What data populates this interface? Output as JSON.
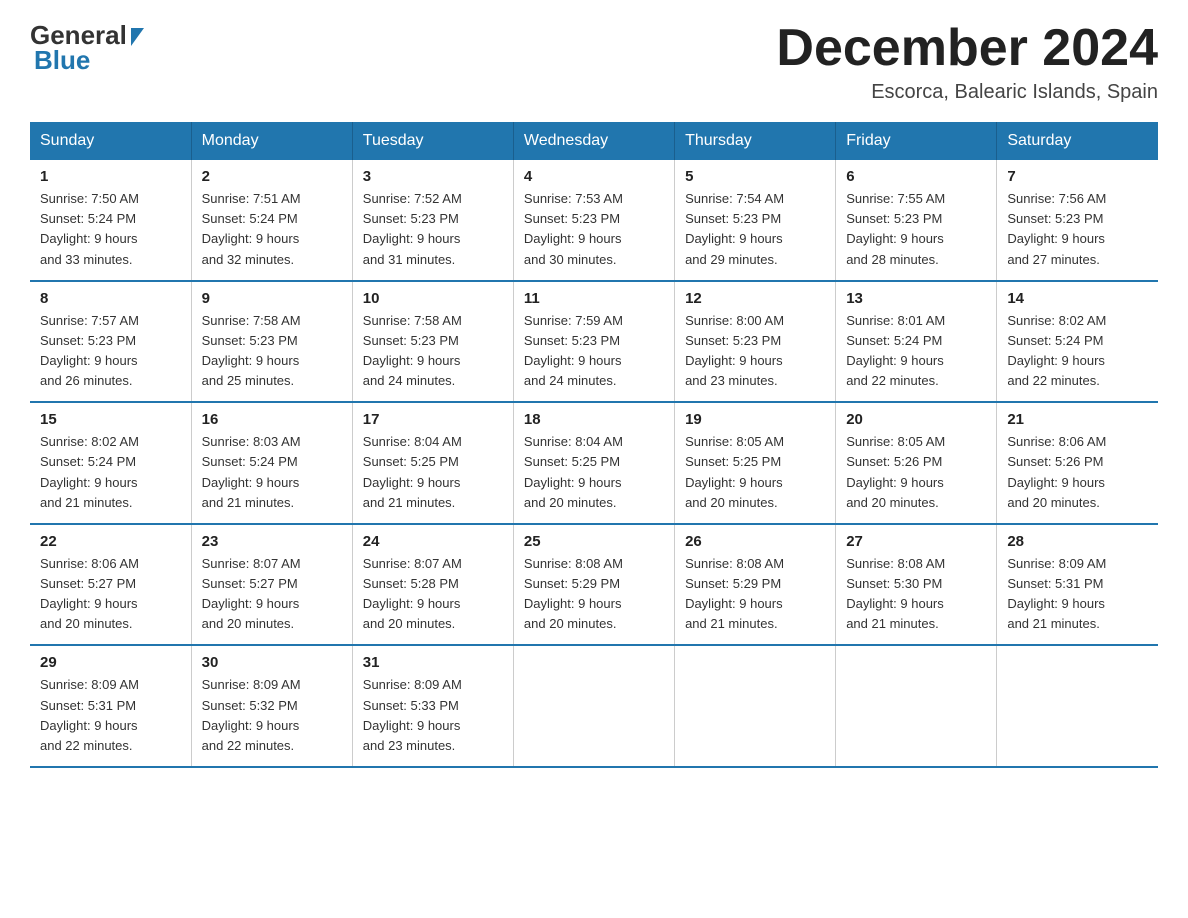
{
  "header": {
    "logo_general": "General",
    "logo_blue": "Blue",
    "month_title": "December 2024",
    "subtitle": "Escorca, Balearic Islands, Spain"
  },
  "weekdays": [
    "Sunday",
    "Monday",
    "Tuesday",
    "Wednesday",
    "Thursday",
    "Friday",
    "Saturday"
  ],
  "weeks": [
    [
      {
        "day": "1",
        "sunrise": "7:50 AM",
        "sunset": "5:24 PM",
        "daylight": "9 hours and 33 minutes."
      },
      {
        "day": "2",
        "sunrise": "7:51 AM",
        "sunset": "5:24 PM",
        "daylight": "9 hours and 32 minutes."
      },
      {
        "day": "3",
        "sunrise": "7:52 AM",
        "sunset": "5:23 PM",
        "daylight": "9 hours and 31 minutes."
      },
      {
        "day": "4",
        "sunrise": "7:53 AM",
        "sunset": "5:23 PM",
        "daylight": "9 hours and 30 minutes."
      },
      {
        "day": "5",
        "sunrise": "7:54 AM",
        "sunset": "5:23 PM",
        "daylight": "9 hours and 29 minutes."
      },
      {
        "day": "6",
        "sunrise": "7:55 AM",
        "sunset": "5:23 PM",
        "daylight": "9 hours and 28 minutes."
      },
      {
        "day": "7",
        "sunrise": "7:56 AM",
        "sunset": "5:23 PM",
        "daylight": "9 hours and 27 minutes."
      }
    ],
    [
      {
        "day": "8",
        "sunrise": "7:57 AM",
        "sunset": "5:23 PM",
        "daylight": "9 hours and 26 minutes."
      },
      {
        "day": "9",
        "sunrise": "7:58 AM",
        "sunset": "5:23 PM",
        "daylight": "9 hours and 25 minutes."
      },
      {
        "day": "10",
        "sunrise": "7:58 AM",
        "sunset": "5:23 PM",
        "daylight": "9 hours and 24 minutes."
      },
      {
        "day": "11",
        "sunrise": "7:59 AM",
        "sunset": "5:23 PM",
        "daylight": "9 hours and 24 minutes."
      },
      {
        "day": "12",
        "sunrise": "8:00 AM",
        "sunset": "5:23 PM",
        "daylight": "9 hours and 23 minutes."
      },
      {
        "day": "13",
        "sunrise": "8:01 AM",
        "sunset": "5:24 PM",
        "daylight": "9 hours and 22 minutes."
      },
      {
        "day": "14",
        "sunrise": "8:02 AM",
        "sunset": "5:24 PM",
        "daylight": "9 hours and 22 minutes."
      }
    ],
    [
      {
        "day": "15",
        "sunrise": "8:02 AM",
        "sunset": "5:24 PM",
        "daylight": "9 hours and 21 minutes."
      },
      {
        "day": "16",
        "sunrise": "8:03 AM",
        "sunset": "5:24 PM",
        "daylight": "9 hours and 21 minutes."
      },
      {
        "day": "17",
        "sunrise": "8:04 AM",
        "sunset": "5:25 PM",
        "daylight": "9 hours and 21 minutes."
      },
      {
        "day": "18",
        "sunrise": "8:04 AM",
        "sunset": "5:25 PM",
        "daylight": "9 hours and 20 minutes."
      },
      {
        "day": "19",
        "sunrise": "8:05 AM",
        "sunset": "5:25 PM",
        "daylight": "9 hours and 20 minutes."
      },
      {
        "day": "20",
        "sunrise": "8:05 AM",
        "sunset": "5:26 PM",
        "daylight": "9 hours and 20 minutes."
      },
      {
        "day": "21",
        "sunrise": "8:06 AM",
        "sunset": "5:26 PM",
        "daylight": "9 hours and 20 minutes."
      }
    ],
    [
      {
        "day": "22",
        "sunrise": "8:06 AM",
        "sunset": "5:27 PM",
        "daylight": "9 hours and 20 minutes."
      },
      {
        "day": "23",
        "sunrise": "8:07 AM",
        "sunset": "5:27 PM",
        "daylight": "9 hours and 20 minutes."
      },
      {
        "day": "24",
        "sunrise": "8:07 AM",
        "sunset": "5:28 PM",
        "daylight": "9 hours and 20 minutes."
      },
      {
        "day": "25",
        "sunrise": "8:08 AM",
        "sunset": "5:29 PM",
        "daylight": "9 hours and 20 minutes."
      },
      {
        "day": "26",
        "sunrise": "8:08 AM",
        "sunset": "5:29 PM",
        "daylight": "9 hours and 21 minutes."
      },
      {
        "day": "27",
        "sunrise": "8:08 AM",
        "sunset": "5:30 PM",
        "daylight": "9 hours and 21 minutes."
      },
      {
        "day": "28",
        "sunrise": "8:09 AM",
        "sunset": "5:31 PM",
        "daylight": "9 hours and 21 minutes."
      }
    ],
    [
      {
        "day": "29",
        "sunrise": "8:09 AM",
        "sunset": "5:31 PM",
        "daylight": "9 hours and 22 minutes."
      },
      {
        "day": "30",
        "sunrise": "8:09 AM",
        "sunset": "5:32 PM",
        "daylight": "9 hours and 22 minutes."
      },
      {
        "day": "31",
        "sunrise": "8:09 AM",
        "sunset": "5:33 PM",
        "daylight": "9 hours and 23 minutes."
      },
      null,
      null,
      null,
      null
    ]
  ],
  "sunrise_label": "Sunrise: ",
  "sunset_label": "Sunset: ",
  "daylight_label": "Daylight: "
}
